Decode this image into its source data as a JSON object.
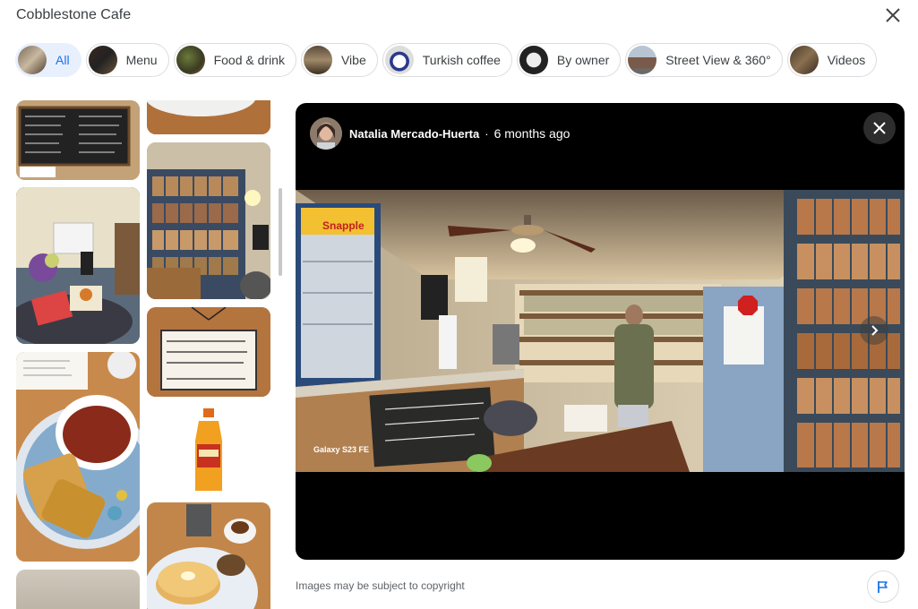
{
  "header": {
    "title": "Cobblestone Cafe"
  },
  "chips": [
    {
      "label": "All",
      "active": true
    },
    {
      "label": "Menu"
    },
    {
      "label": "Food & drink"
    },
    {
      "label": "Vibe"
    },
    {
      "label": "Turkish coffee"
    },
    {
      "label": "By owner"
    },
    {
      "label": "Street View & 360°"
    },
    {
      "label": "Videos"
    }
  ],
  "viewer": {
    "author": "Natalia Mercado-Huerta",
    "separator": "·",
    "time": "6 months ago",
    "camera": "Galaxy S23 FE"
  },
  "footer": {
    "copyright": "Images may be subject to copyright"
  },
  "icons": {
    "close": "close-icon",
    "viewer_close": "close-icon",
    "next": "chevron-right-icon",
    "flag": "flag-icon"
  },
  "colors": {
    "accent": "#1a73e8",
    "active_chip_bg": "#e8f0fe"
  }
}
